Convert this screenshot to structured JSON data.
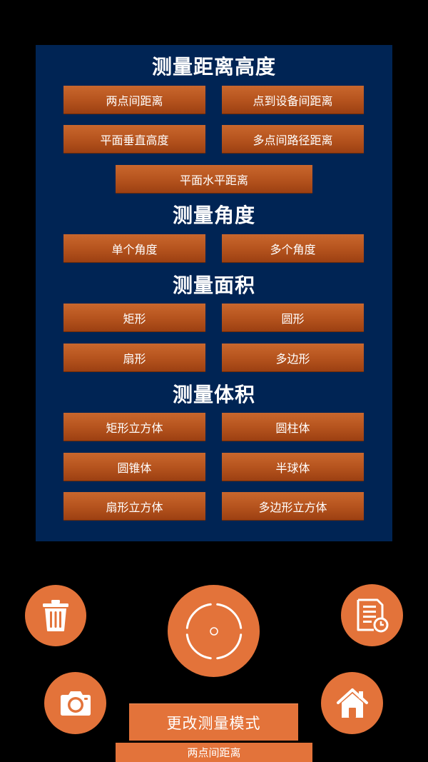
{
  "sections": {
    "distance": {
      "title": "测量距离高度",
      "buttons": [
        "两点间距离",
        "点到设备间距离",
        "平面垂直高度",
        "多点间路径距离",
        "平面水平距离"
      ]
    },
    "angle": {
      "title": "测量角度",
      "buttons": [
        "单个角度",
        "多个角度"
      ]
    },
    "area": {
      "title": "测量面积",
      "buttons": [
        "矩形",
        "圆形",
        "扇形",
        "多边形"
      ]
    },
    "volume": {
      "title": "测量体积",
      "buttons": [
        "矩形立方体",
        "圆柱体",
        "圆锥体",
        "半球体",
        "扇形立方体",
        "多边形立方体"
      ]
    }
  },
  "controls": {
    "delete_icon": "trash-icon",
    "capture_icon": "crosshair-icon",
    "history_icon": "document-clock-icon",
    "camera_icon": "camera-icon",
    "home_icon": "home-icon",
    "change_mode_label": "更改测量模式",
    "current_mode": "两点间距离"
  },
  "colors": {
    "panel_bg": "#002454",
    "accent": "#e3733a",
    "button_orange": "#b4521d"
  }
}
